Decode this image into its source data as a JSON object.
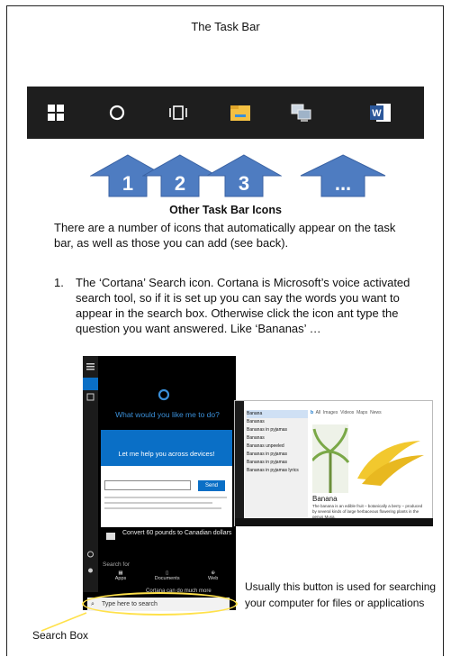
{
  "page": {
    "title": "The Task Bar",
    "subheading": "Other Task Bar Icons",
    "intro": "There are a number of icons that automatically appear on the task bar, as well as those you can add (see back).",
    "list_item": {
      "number": "1.",
      "text": "The ‘Cortana’ Search icon. Cortana is Microsoft’s voice activated search tool, so if it is set up you can say the words you want to appear in the search box. Otherwise click the icon ant type the question you want answered. Like ‘Bananas’ …"
    },
    "arrows": [
      "1",
      "2",
      "3",
      "..."
    ],
    "taskbar_icons": [
      "windows-start-icon",
      "cortana-circle-icon",
      "task-view-icon",
      "file-explorer-icon",
      "network-computer-icon",
      "word-icon"
    ],
    "cortana_panel": {
      "question": "What would you like me to do?",
      "help_line": "Let me help you across devices!",
      "send_label": "Send",
      "convert_text": "Convert 60 pounds to Canadian dollars",
      "search_for": "Search for",
      "categories": [
        "Apps",
        "Documents",
        "Web"
      ],
      "more": "Cortana can do much more",
      "search_placeholder": "Type here to search"
    },
    "results_panel": {
      "best_match": "Banana",
      "suggestions": [
        "Bananas",
        "Bananas in pyjamas",
        "Bananas",
        "Bananas unpeeled",
        "Bananas in pyjamas",
        "Bananas in pyjamas",
        "Bananas in pyjamas lyrics"
      ],
      "tabs": [
        "All",
        "Images",
        "Videos",
        "Maps",
        "News"
      ],
      "title": "Banana",
      "description": "The banana is an edible fruit – botanically a berry – produced by several kinds of large herbaceous flowering plants in the genus Musa."
    },
    "labels": {
      "search_box": "Search Box",
      "caption": "Usually this button is used for searching your computer for files or applications"
    },
    "colors": {
      "arrow": "#4e7cc1",
      "taskbar": "#1e1e1e",
      "highlight": "#ffe14a"
    }
  }
}
